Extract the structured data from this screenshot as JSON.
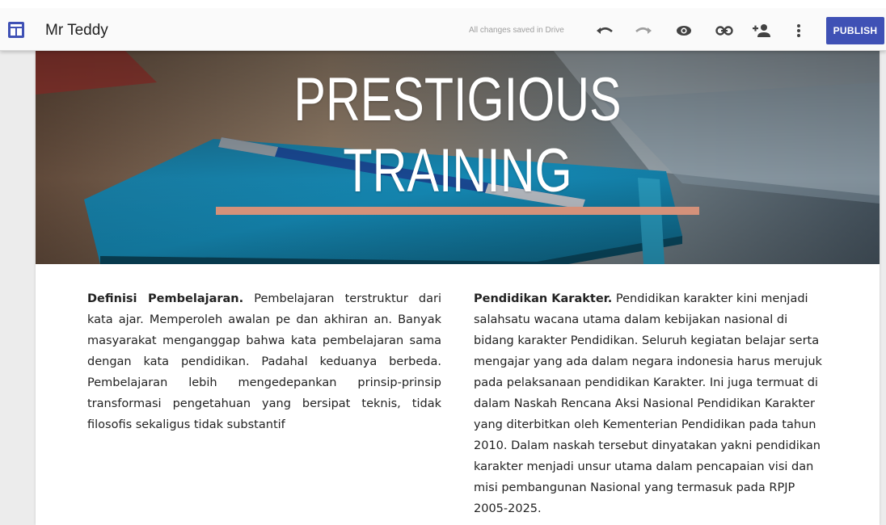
{
  "app": {
    "site_name": "Mr Teddy",
    "save_status": "All changes saved in Drive",
    "publish_label": "PUBLISH",
    "icons": [
      "sites-layout-icon",
      "undo-icon",
      "redo-icon",
      "preview-eye-icon",
      "link-icon",
      "add-person-icon",
      "more-vert-icon"
    ],
    "accent_color": "#3f51b5"
  },
  "hero": {
    "title_line1": "PRESTIGIOUS",
    "title_line2": "TRAINING",
    "underline_color": "#d4917a"
  },
  "content": {
    "left_heading": "Definisi Pembelajaran.",
    "left_body": " Pembelajaran terstruktur dari kata ajar. Memperoleh awalan pe dan akhiran an. Banyak masyarakat menganggap bahwa kata pembelajaran sama dengan kata pendidikan. Padahal keduanya berbeda. Pembelajaran lebih mengedepankan prinsip-prinsip transformasi pengetahuan yang bersipat teknis, tidak filosofis sekaligus tidak substantif",
    "right_heading": "Pendidikan Karakter.",
    "right_body": " Pendidikan karakter kini menjadi salahsatu wacana utama dalam kebijakan nasional di bidang karakter Pendidikan. Seluruh kegiatan belajar serta mengajar yang ada dalam negara indonesia harus merujuk pada pelaksanaan pendidikan Karakter. Ini juga termuat di dalam Naskah Rencana Aksi Nasional Pendidikan Karakter yang diterbitkan oleh Kementerian Pendidikan pada tahun 2010. Dalam naskah tersebut dinyatakan yakni pendidikan karakter menjadi unsur utama dalam pencapaian visi dan misi pembangunan Nasional yang termasuk pada RPJP 2005-2025."
  }
}
